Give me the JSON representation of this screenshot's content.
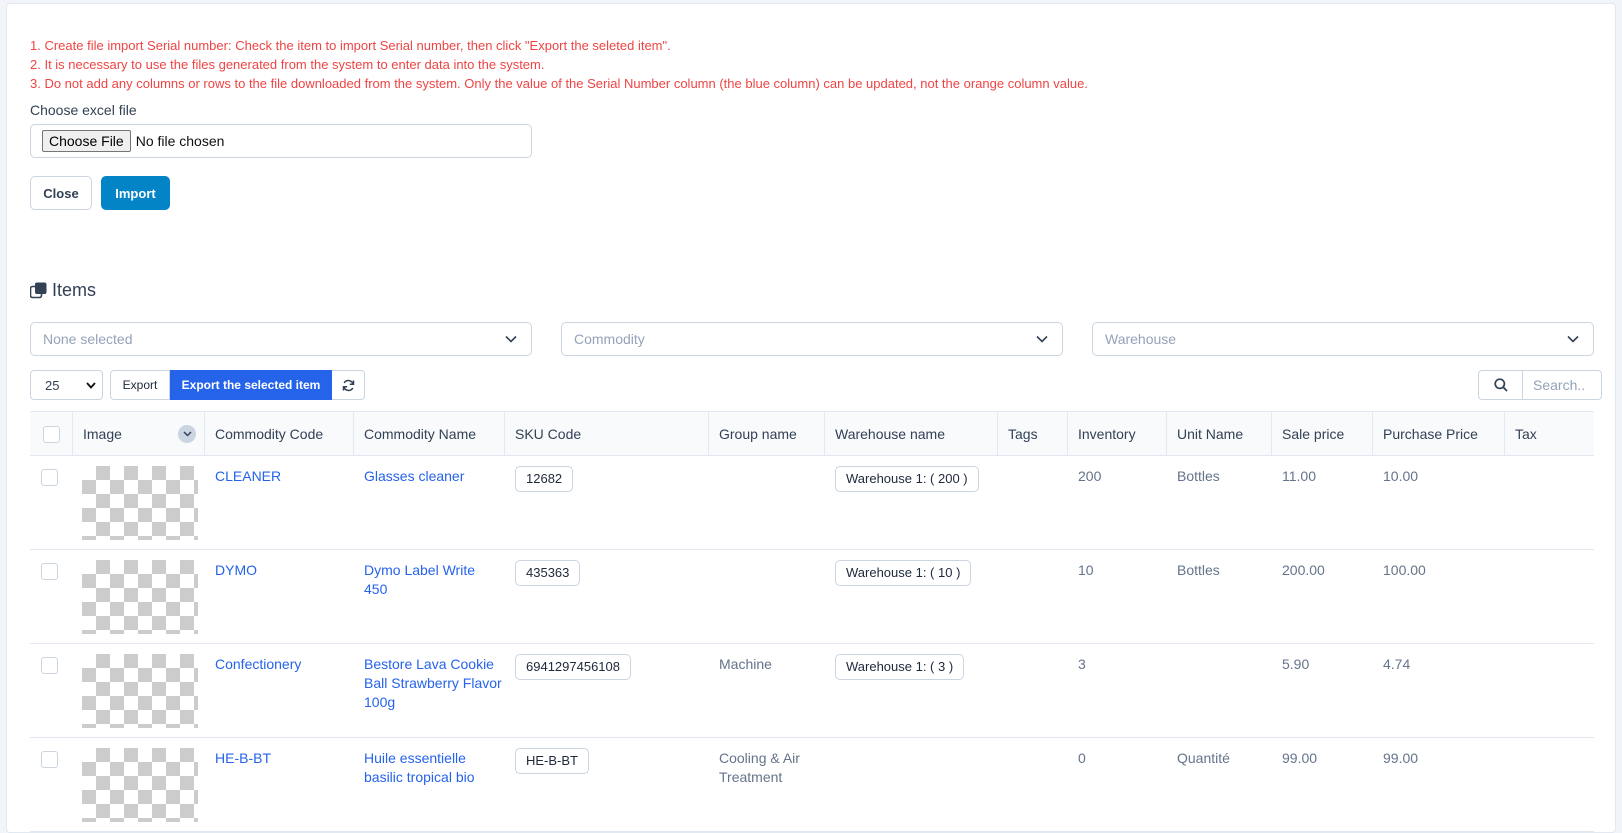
{
  "notes": [
    "1. Create file import Serial number: Check the item to import Serial number, then click \"Export the seleted item\".",
    "2. It is necessary to use the files generated from the system to enter data into the system.",
    "3. Do not add any columns or rows to the file downloaded from the system. Only the value of the Serial Number column (the blue column) can be updated, not the orange column value."
  ],
  "file": {
    "label": "Choose excel file",
    "button": "Choose File",
    "status": "No file chosen"
  },
  "actions": {
    "close": "Close",
    "import": "Import"
  },
  "items": {
    "title": "Items",
    "filters": {
      "group": "None selected",
      "commodity": "Commodity",
      "warehouse": "Warehouse"
    },
    "page_size": "25",
    "export": "Export",
    "export_selected": "Export the selected item",
    "search_placeholder": "Search.."
  },
  "table": {
    "headers": [
      "Image",
      "Commodity Code",
      "Commodity Name",
      "SKU Code",
      "Group name",
      "Warehouse name",
      "Tags",
      "Inventory",
      "Unit Name",
      "Sale price",
      "Purchase Price",
      "Tax"
    ],
    "rows": [
      {
        "code": "CLEANER",
        "name": "Glasses cleaner",
        "sku": "12682",
        "group": "",
        "warehouse": "Warehouse 1: ( 200 )",
        "tags": "",
        "inventory": "200",
        "unit": "Bottles",
        "sale": "11.00",
        "purchase": "10.00"
      },
      {
        "code": "DYMO",
        "name": "Dymo Label Write 450",
        "sku": "435363",
        "group": "",
        "warehouse": "Warehouse 1: ( 10 )",
        "tags": "",
        "inventory": "10",
        "unit": "Bottles",
        "sale": "200.00",
        "purchase": "100.00"
      },
      {
        "code": "Confectionery",
        "name": "Bestore Lava Cookie Ball Strawberry Flavor 100g",
        "sku": "6941297456108",
        "group": "Machine",
        "warehouse": "Warehouse 1: ( 3 )",
        "tags": "",
        "inventory": "3",
        "unit": "",
        "sale": "5.90",
        "purchase": "4.74"
      },
      {
        "code": "HE-B-BT",
        "name": "Huile essentielle basilic tropical bio",
        "sku": "HE-B-BT",
        "group": "Cooling & Air Treatment",
        "warehouse": "",
        "tags": "",
        "inventory": "0",
        "unit": "Quantité",
        "sale": "99.00",
        "purchase": "99.00"
      }
    ]
  },
  "colors": {
    "primary": "#2563eb",
    "import": "#0284c7",
    "warning_text": "#ef4444"
  }
}
